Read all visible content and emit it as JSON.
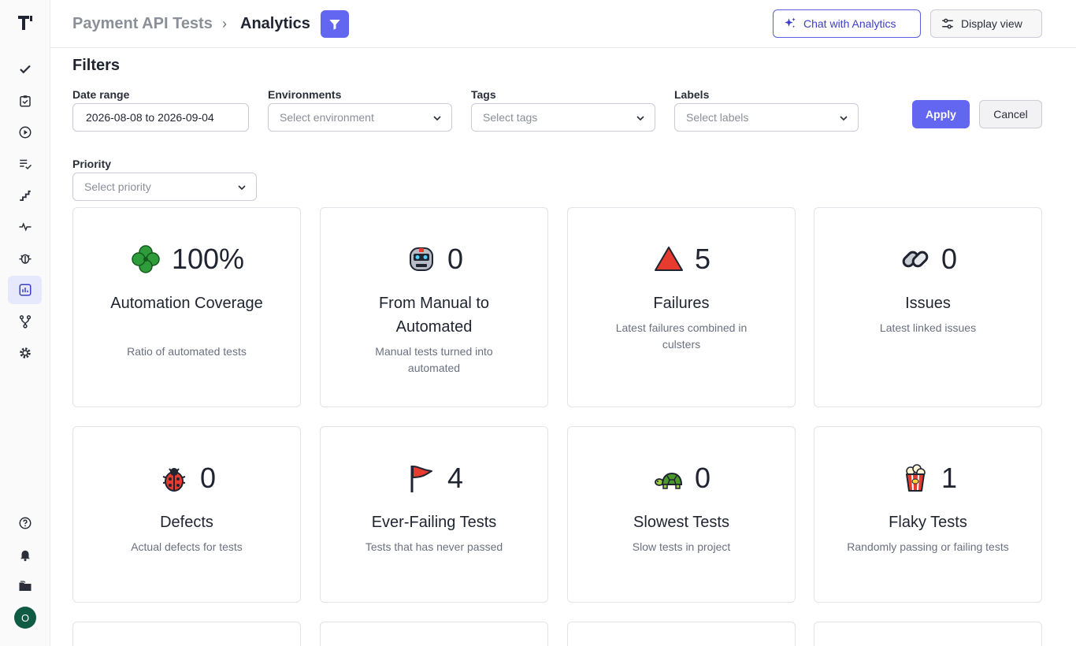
{
  "sidebar": {
    "items": [
      {
        "icon": "check-icon"
      },
      {
        "icon": "clipboard-check-icon"
      },
      {
        "icon": "play-circle-icon"
      },
      {
        "icon": "list-check-icon"
      },
      {
        "icon": "stairs-icon"
      },
      {
        "icon": "pulse-icon"
      },
      {
        "icon": "bug-icon"
      },
      {
        "icon": "bar-chart-icon"
      },
      {
        "icon": "branch-icon"
      },
      {
        "icon": "gear-icon"
      }
    ],
    "bottom": [
      {
        "icon": "help-icon"
      },
      {
        "icon": "bell-icon"
      },
      {
        "icon": "folder-icon"
      }
    ],
    "avatar_initial": "O"
  },
  "header": {
    "project": "Payment API Tests",
    "separator": "›",
    "page": "Analytics",
    "chat_label": "Chat with Analytics",
    "display_label": "Display view"
  },
  "filters": {
    "title": "Filters",
    "date_range": {
      "label": "Date range",
      "value": "2026-08-08 to 2026-09-04"
    },
    "environments": {
      "label": "Environments",
      "placeholder": "Select environment"
    },
    "tags": {
      "label": "Tags",
      "placeholder": "Select tags"
    },
    "labels": {
      "label": "Labels",
      "placeholder": "Select labels"
    },
    "priority": {
      "label": "Priority",
      "placeholder": "Select priority"
    },
    "apply_label": "Apply",
    "cancel_label": "Cancel"
  },
  "cards": [
    {
      "value": "100%",
      "title": "Automation Coverage",
      "desc": "Ratio of automated tests",
      "icon": "clover-icon"
    },
    {
      "value": "0",
      "title": "From Manual to Automated",
      "desc": "Manual tests turned into automated",
      "icon": "robot-icon"
    },
    {
      "value": "5",
      "title": "Failures",
      "desc": "Latest failures combined in culsters",
      "icon": "red-triangle-icon"
    },
    {
      "value": "0",
      "title": "Issues",
      "desc": "Latest linked issues",
      "icon": "chain-link-icon"
    },
    {
      "value": "0",
      "title": "Defects",
      "desc": "Actual defects for tests",
      "icon": "ladybug-icon"
    },
    {
      "value": "4",
      "title": "Ever-Failing Tests",
      "desc": "Tests that has never passed",
      "icon": "red-flag-icon"
    },
    {
      "value": "0",
      "title": "Slowest Tests",
      "desc": "Slow tests in project",
      "icon": "turtle-icon"
    },
    {
      "value": "1",
      "title": "Flaky Tests",
      "desc": "Randomly passing or failing tests",
      "icon": "popcorn-icon"
    }
  ],
  "colors": {
    "accent": "#6366f1",
    "avatar": "#0f5b43"
  }
}
